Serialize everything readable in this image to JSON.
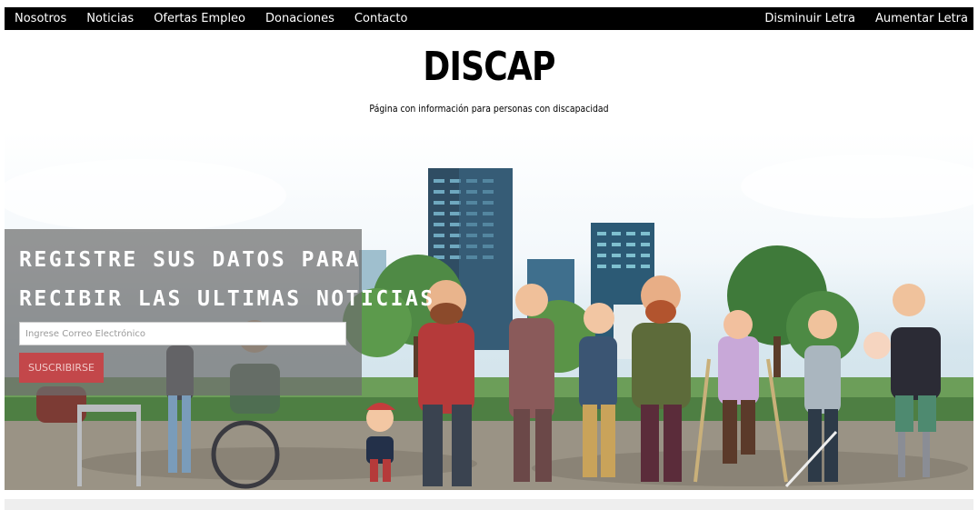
{
  "nav": {
    "left_items": [
      {
        "label": "Nosotros"
      },
      {
        "label": "Noticias"
      },
      {
        "label": "Ofertas Empleo"
      },
      {
        "label": "Donaciones"
      },
      {
        "label": "Contacto"
      }
    ],
    "right_items": [
      {
        "label": "Disminuir Letra"
      },
      {
        "label": "Aumentar Letra"
      }
    ]
  },
  "header": {
    "title": "DISCAP",
    "subtitle": "Página con información para personas con discapacidad"
  },
  "subscribe": {
    "heading_line1": "REGISTRE SUS DATOS PARA",
    "heading_line2": "RECIBIR LAS ULTIMAS NOTICIAS",
    "email_placeholder": "Ingrese Correo Electrónico",
    "button_label": "SUSCRIBIRSE"
  },
  "colors": {
    "nav_background": "#000000",
    "nav_text": "#ffffff",
    "panel_overlay": "rgba(110,110,110,0.72)",
    "button_red": "#c3474a"
  }
}
